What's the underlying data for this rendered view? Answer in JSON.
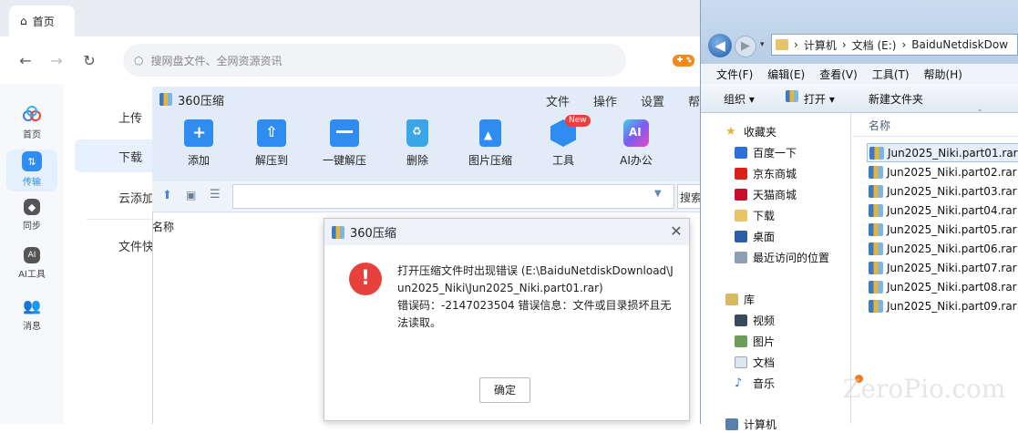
{
  "baidu": {
    "tab_label": "首页",
    "search_placeholder": "搜网盘文件、全网资源资讯",
    "sidebar": [
      {
        "label": "首页",
        "icon": "cloud-home-icon"
      },
      {
        "label": "传输",
        "icon": "transfer-icon"
      },
      {
        "label": "同步",
        "icon": "sync-icon"
      },
      {
        "label": "AI工具",
        "icon": "ai-tool-icon"
      },
      {
        "label": "消息",
        "icon": "message-icon"
      }
    ],
    "panel": [
      "上传",
      "下载",
      "云添加",
      "文件快"
    ]
  },
  "zip": {
    "title": "360压缩",
    "menu": [
      "文件",
      "操作",
      "设置",
      "帮"
    ],
    "toolbar": [
      {
        "label": "添加",
        "icon": "add-icon"
      },
      {
        "label": "解压到",
        "icon": "extract-to-icon"
      },
      {
        "label": "一键解压",
        "icon": "one-click-extract-icon"
      },
      {
        "label": "删除",
        "icon": "delete-icon"
      },
      {
        "label": "图片压缩",
        "icon": "image-compress-icon"
      },
      {
        "label": "工具",
        "icon": "tools-icon",
        "badge": "New"
      },
      {
        "label": "AI办公",
        "icon": "ai-office-icon"
      }
    ],
    "search_label": "搜索",
    "column_name": "名称"
  },
  "dialog": {
    "title": "360压缩",
    "message_line1": "打开压缩文件时出现错误 (E:\\BaiduNetdiskDownload\\Jun2025_Niki\\Jun2025_Niki.part01.rar)",
    "message_line2": " 错误码：-2147023504 错误信息：文件或目录损坏且无法读取。",
    "ok_label": "确定",
    "close_glyph": "✕"
  },
  "explorer": {
    "path": [
      "计算机",
      "文档 (E:)",
      "BaiduNetdiskDow"
    ],
    "menu": [
      "文件(F)",
      "编辑(E)",
      "查看(V)",
      "工具(T)",
      "帮助(H)"
    ],
    "cmd": {
      "organize": "组织 ▾",
      "open": "打开 ▾",
      "new_folder": "新建文件夹"
    },
    "favorites_header": "收藏夹",
    "favorites": [
      "百度一下",
      "京东商城",
      "天猫商城",
      "下载",
      "桌面",
      "最近访问的位置"
    ],
    "library_header": "库",
    "library": [
      "视频",
      "图片",
      "文档",
      "音乐"
    ],
    "computer_label": "计算机",
    "column_name": "名称",
    "files": [
      "Jun2025_Niki.part01.rar",
      "Jun2025_Niki.part02.rar",
      "Jun2025_Niki.part03.rar",
      "Jun2025_Niki.part04.rar",
      "Jun2025_Niki.part05.rar",
      "Jun2025_Niki.part06.rar",
      "Jun2025_Niki.part07.rar",
      "Jun2025_Niki.part08.rar",
      "Jun2025_Niki.part09.rar"
    ],
    "watermark": "ZeroPio.com"
  }
}
